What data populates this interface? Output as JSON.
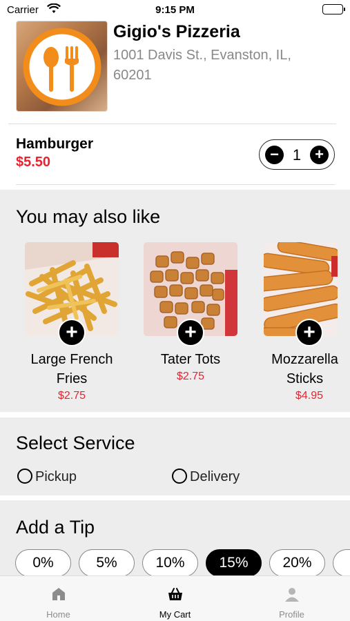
{
  "status_bar": {
    "carrier": "Carrier",
    "time": "9:15 PM"
  },
  "restaurant": {
    "name": "Gigio's Pizzeria",
    "address": "1001 Davis St., Evanston, IL, 60201",
    "logo_icon": "fork-spoon-logo"
  },
  "cart_item": {
    "name": "Hamburger",
    "price": "$5.50",
    "quantity": "1",
    "minus_label": "−",
    "plus_label": "+"
  },
  "suggestions": {
    "title": "You may also like",
    "items": [
      {
        "name": "Large French Fries",
        "price": "$2.75",
        "add_label": "+"
      },
      {
        "name": "Tater Tots",
        "price": "$2.75",
        "add_label": "+"
      },
      {
        "name": "Mozzarella Sticks",
        "price": "$4.95",
        "add_label": "+"
      }
    ]
  },
  "service": {
    "title": "Select Service",
    "options": [
      "Pickup",
      "Delivery"
    ]
  },
  "tip": {
    "title": "Add a Tip",
    "options": [
      "0%",
      "5%",
      "10%",
      "15%",
      "20%"
    ],
    "selected": "15%"
  },
  "tab_bar": {
    "tabs": [
      {
        "label": "Home",
        "icon": "home-icon"
      },
      {
        "label": "My Cart",
        "icon": "basket-icon"
      },
      {
        "label": "Profile",
        "icon": "person-icon"
      }
    ],
    "active": "My Cart"
  },
  "colors": {
    "price_red": "#e8222f",
    "accent_orange": "#f28c1a",
    "section_bg": "#ededed"
  }
}
